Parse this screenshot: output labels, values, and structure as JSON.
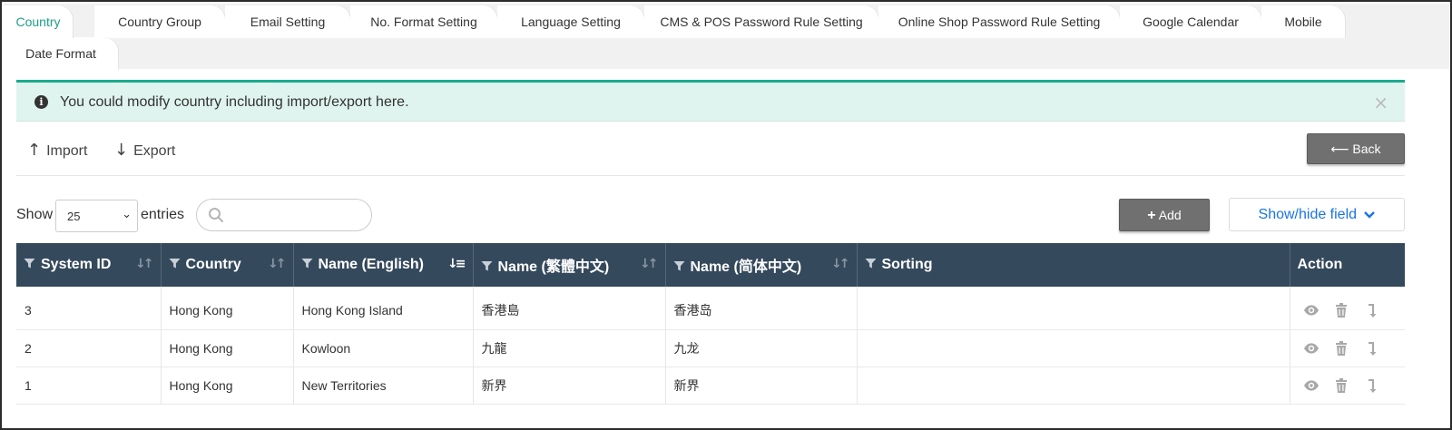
{
  "tabs": [
    {
      "label": "Country",
      "active": true
    },
    {
      "label": "Country Group"
    },
    {
      "label": "Email Setting"
    },
    {
      "label": "No. Format Setting"
    },
    {
      "label": "Language Setting"
    },
    {
      "label": "CMS & POS Password Rule Setting"
    },
    {
      "label": "Online Shop Password Rule Setting"
    },
    {
      "label": "Google Calendar"
    },
    {
      "label": "Mobile"
    },
    {
      "label": "Date Format"
    }
  ],
  "alert": {
    "icon": "info-icon",
    "message": "You could modify country including import/export here.",
    "close_glyph": "×"
  },
  "toolbar": {
    "import_label": "Import",
    "export_label": "Export",
    "back_label": "Back"
  },
  "controls": {
    "show_label": "Show",
    "entries_value": "25",
    "entries_label": "entries",
    "search_value": "",
    "add_label": "Add",
    "showhide_label": "Show/hide field"
  },
  "table": {
    "headers": [
      "System ID",
      "Country",
      "Name (English)",
      "Name (繁體中文)",
      "Name (简体中文)",
      "Sorting",
      "Action"
    ],
    "sorted_column": "Name (English)",
    "rows": [
      {
        "id": "3",
        "country": "Hong Kong",
        "name_en": "Hong Kong Island",
        "name_tc": "香港島",
        "name_sc": "香港岛",
        "sorting": ""
      },
      {
        "id": "2",
        "country": "Hong Kong",
        "name_en": "Kowloon",
        "name_tc": "九龍",
        "name_sc": "九龙",
        "sorting": ""
      },
      {
        "id": "1",
        "country": "Hong Kong",
        "name_en": "New Territories",
        "name_tc": "新界",
        "name_sc": "新界",
        "sorting": ""
      }
    ],
    "row_actions": [
      "view-icon",
      "trash-icon",
      "move-down-icon"
    ]
  },
  "colors": {
    "accent": "#1f9f86",
    "header_bg": "#35495c",
    "alert_bg": "#dff4ee",
    "button_bg": "#707070",
    "link_blue": "#1a73e8"
  }
}
